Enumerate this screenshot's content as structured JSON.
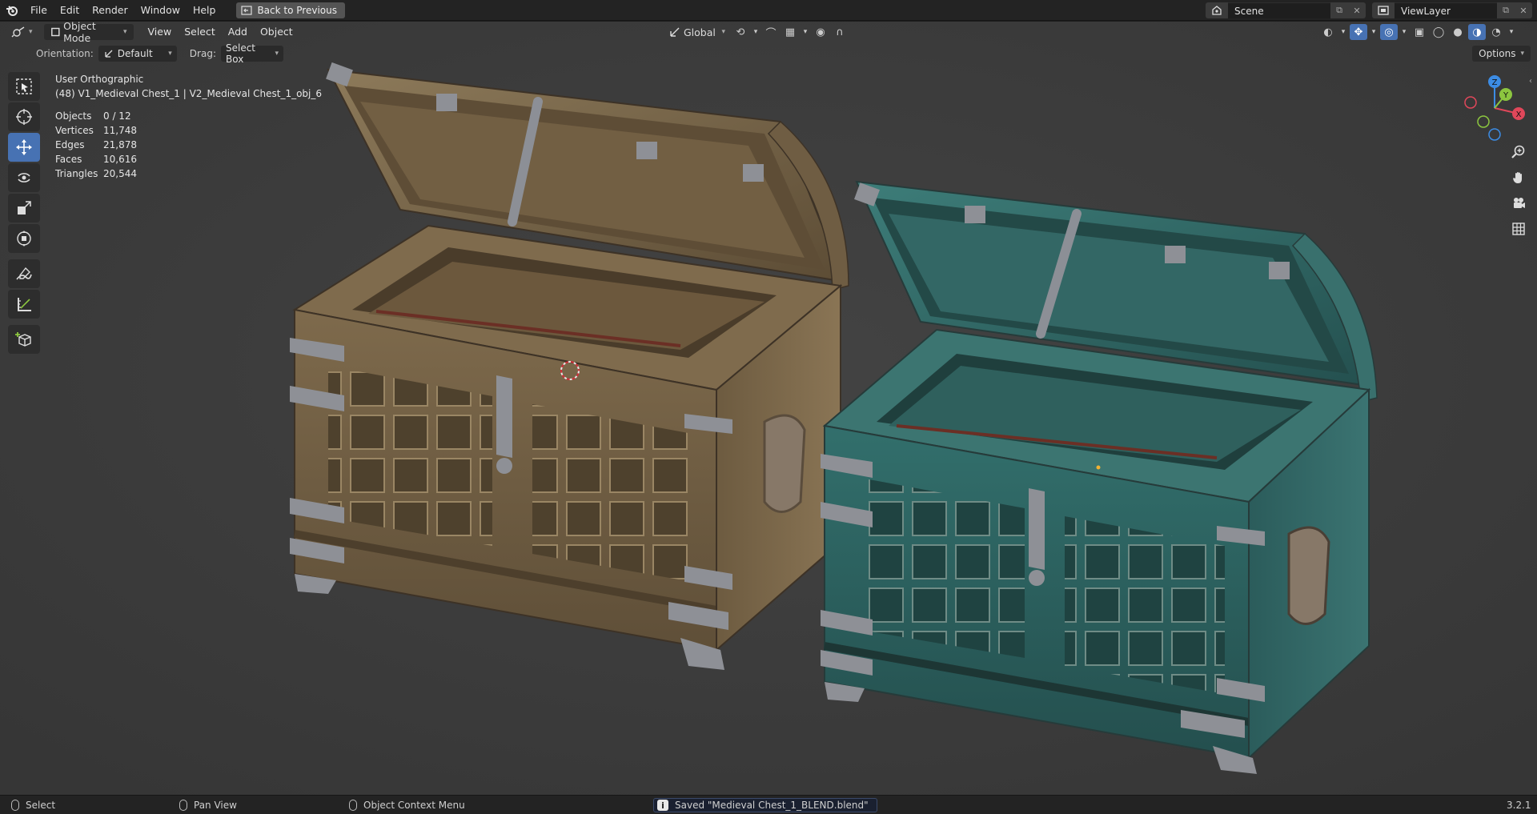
{
  "menu": {
    "items": [
      "File",
      "Edit",
      "Render",
      "Window",
      "Help"
    ],
    "back_label": "Back to Previous"
  },
  "scene": {
    "name": "Scene",
    "view_layer": "ViewLayer"
  },
  "header": {
    "mode": "Object Mode",
    "menus": [
      "View",
      "Select",
      "Add",
      "Object"
    ],
    "transform_orientation": "Global"
  },
  "tool_settings": {
    "orientation_label": "Orientation:",
    "orientation_value": "Default",
    "drag_label": "Drag:",
    "drag_value": "Select Box",
    "options_label": "Options"
  },
  "overlay": {
    "view_name": "User Orthographic",
    "collection_line": "(48) V1_Medieval Chest_1 | V2_Medieval Chest_1_obj_6",
    "stats": [
      {
        "label": "Objects",
        "value": "0 / 12"
      },
      {
        "label": "Vertices",
        "value": "11,748"
      },
      {
        "label": "Edges",
        "value": "21,878"
      },
      {
        "label": "Faces",
        "value": "10,616"
      },
      {
        "label": "Triangles",
        "value": "20,544"
      }
    ]
  },
  "gizmo": {
    "x": "X",
    "y": "Y",
    "z": "Z"
  },
  "statusbar": {
    "select": "Select",
    "pan": "Pan View",
    "context": "Object Context Menu",
    "saved": "Saved \"Medieval Chest_1_BLEND.blend\"",
    "version": "3.2.1"
  },
  "colors": {
    "accent": "#4772b3",
    "viewport_bg": "#3d3d3d",
    "chest_wood": "#8a7452",
    "chest_teal": "#2f6b6a",
    "metal": "#8e9096",
    "axis_x": "#e0475a",
    "axis_y": "#8cc63f",
    "axis_z": "#3c8ce4"
  },
  "icons": {
    "tools": [
      "select-box-icon",
      "cursor-icon",
      "move-icon",
      "rotate-icon",
      "scale-icon",
      "transform-icon",
      "annotate-icon",
      "measure-icon",
      "add-cube-icon"
    ],
    "nav": [
      "zoom-icon",
      "pan-hand-icon",
      "camera-icon",
      "grid-icon"
    ]
  }
}
